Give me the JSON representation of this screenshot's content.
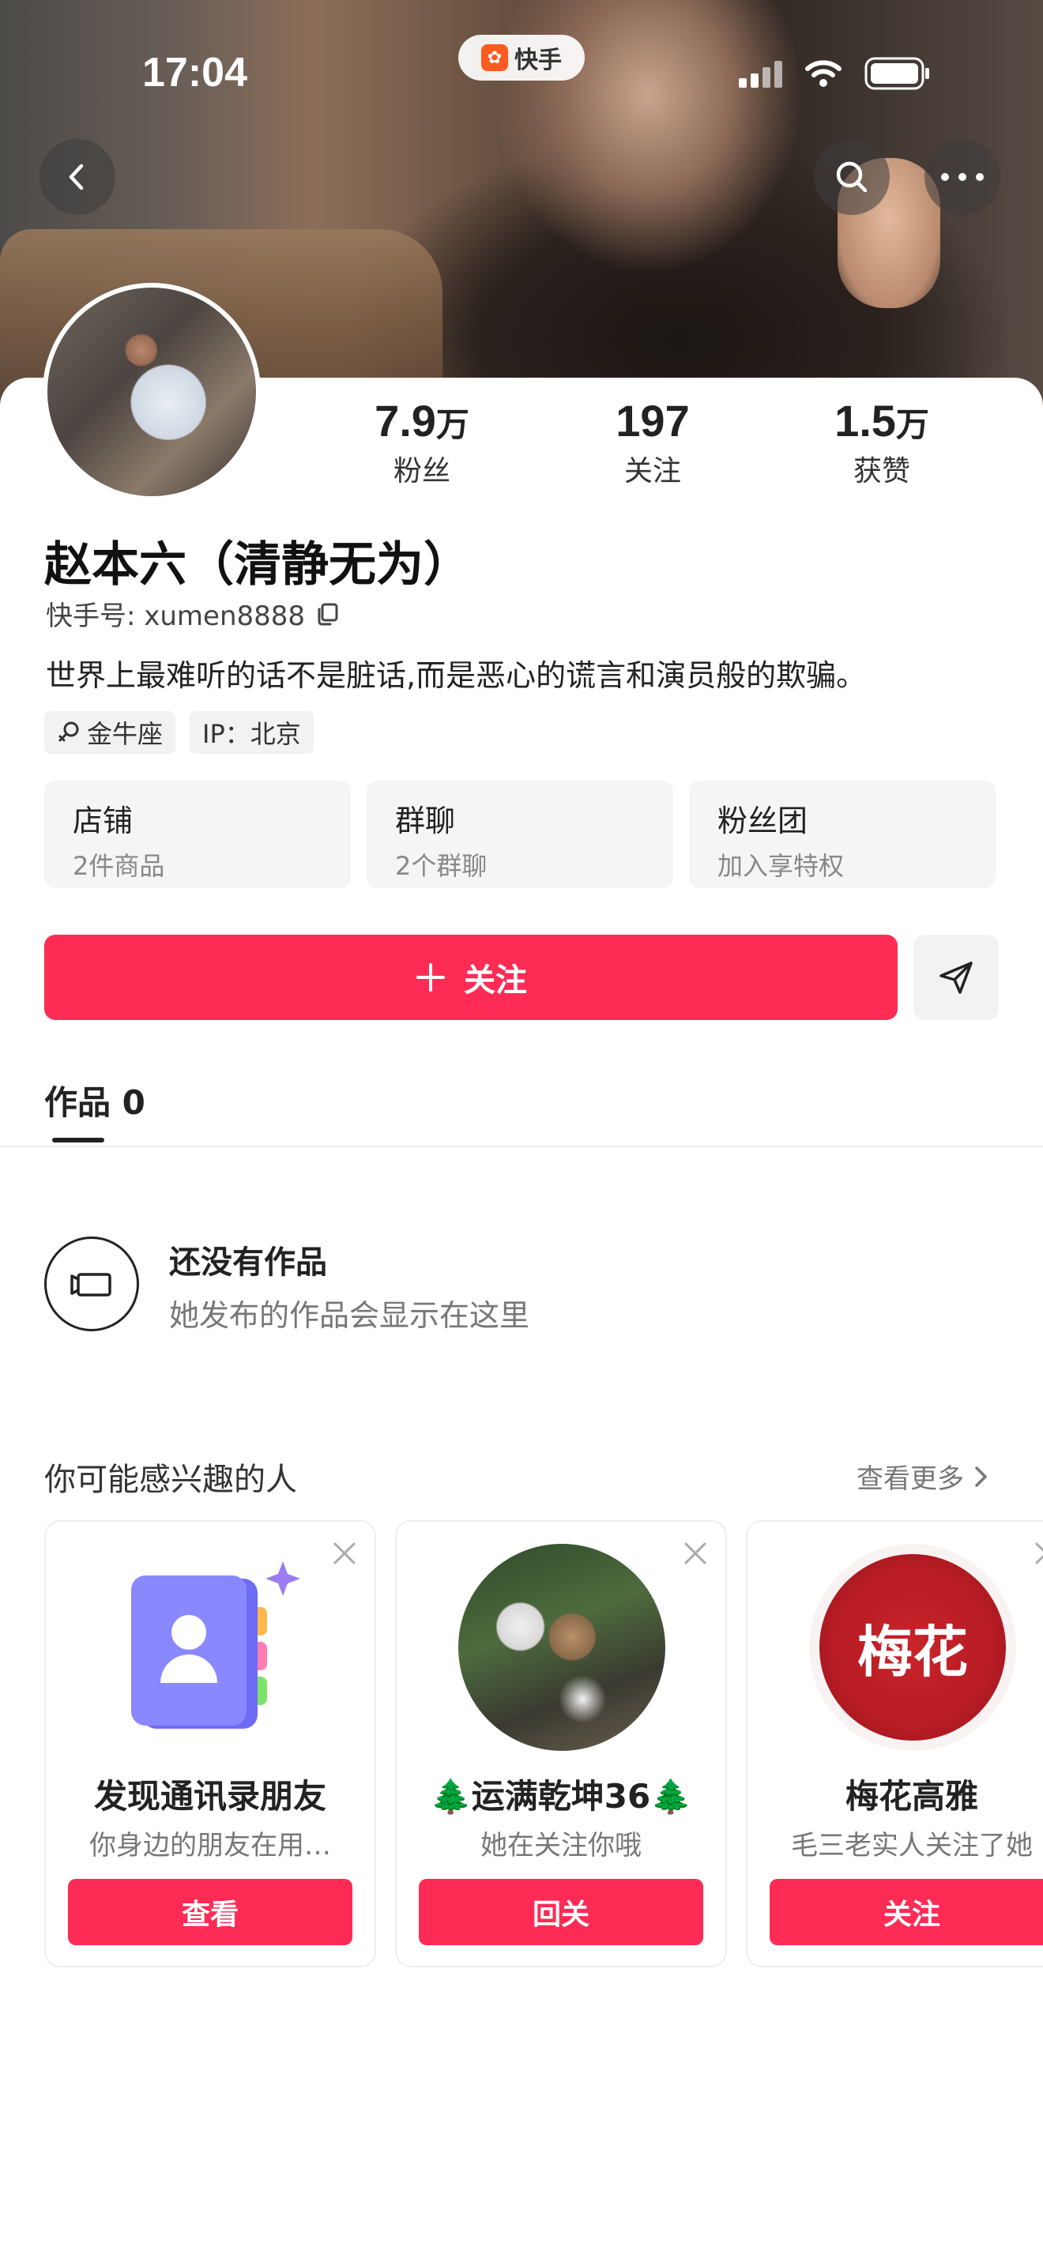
{
  "status_bar": {
    "time": "17:04",
    "app_badge": "快手"
  },
  "profile": {
    "name": "赵本六（清静无为）",
    "kuaishou_id_label": "快手号: xumen8888",
    "bio": "世界上最难听的话不是脏话,而是恶心的谎言和演员般的欺骗。",
    "tags": [
      {
        "label": "金牛座",
        "icon": "female-icon"
      },
      {
        "label": "IP：北京",
        "icon": null
      }
    ],
    "stats": [
      {
        "value": "7.9",
        "unit": "万",
        "label": "粉丝"
      },
      {
        "value": "197",
        "unit": "",
        "label": "关注"
      },
      {
        "value": "1.5",
        "unit": "万",
        "label": "获赞"
      }
    ]
  },
  "features": [
    {
      "title": "店铺",
      "subtitle": "2件商品"
    },
    {
      "title": "群聊",
      "subtitle": "2个群聊"
    },
    {
      "title": "粉丝团",
      "subtitle": "加入享特权"
    }
  ],
  "actions": {
    "follow_label": "关注"
  },
  "tabs": {
    "works_label": "作品 0"
  },
  "empty_state": {
    "title": "还没有作品",
    "subtitle": "她发布的作品会显示在这里"
  },
  "suggestions": {
    "title": "你可能感兴趣的人",
    "more_label": "查看更多",
    "cards": [
      {
        "name": "发现通讯录朋友",
        "subtitle": "你身边的朋友在用…",
        "button": "查看"
      },
      {
        "name": "🌲运满乾坤36🌲",
        "subtitle": "她在关注你哦",
        "button": "回关"
      },
      {
        "name": "梅花高雅",
        "subtitle": "毛三老实人关注了她",
        "button": "关注",
        "avatar_text": "梅花"
      }
    ]
  },
  "colors": {
    "accent": "#fe2c55",
    "card_bg": "#f5f5f5"
  }
}
